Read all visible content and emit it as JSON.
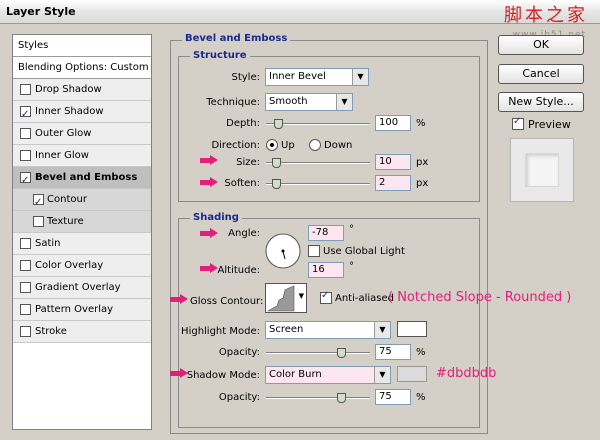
{
  "window": {
    "title": "Layer Style",
    "watermark": "脚本之家",
    "watermark_sub": "www.jb51.net"
  },
  "styles": {
    "header": "Styles",
    "blending": "Blending Options: Custom",
    "items": [
      {
        "label": "Drop Shadow",
        "checked": false
      },
      {
        "label": "Inner Shadow",
        "checked": true
      },
      {
        "label": "Outer Glow",
        "checked": false
      },
      {
        "label": "Inner Glow",
        "checked": false
      },
      {
        "label": "Bevel and Emboss",
        "checked": true,
        "selected": true
      },
      {
        "label": "Contour",
        "checked": true,
        "sub": true
      },
      {
        "label": "Texture",
        "checked": false,
        "sub": true
      },
      {
        "label": "Satin",
        "checked": false
      },
      {
        "label": "Color Overlay",
        "checked": false
      },
      {
        "label": "Gradient Overlay",
        "checked": false
      },
      {
        "label": "Pattern Overlay",
        "checked": false
      },
      {
        "label": "Stroke",
        "checked": false
      }
    ]
  },
  "bevel": {
    "title": "Bevel and Emboss",
    "structure": {
      "title": "Structure",
      "style_label": "Style:",
      "style_value": "Inner Bevel",
      "technique_label": "Technique:",
      "technique_value": "Smooth",
      "depth_label": "Depth:",
      "depth_value": "100",
      "depth_unit": "%",
      "depth_level": 0.08,
      "direction_label": "Direction:",
      "dir_up": "Up",
      "dir_down": "Down",
      "direction_selected": "Up",
      "size_label": "Size:",
      "size_value": "10",
      "size_unit": "px",
      "size_level": 0.06,
      "soften_label": "Soften:",
      "soften_value": "2",
      "soften_unit": "px",
      "soften_level": 0.06
    },
    "shading": {
      "title": "Shading",
      "angle_label": "Angle:",
      "angle_value": "-78",
      "angle_unit": "°",
      "global_light_label": "Use Global Light",
      "global_light": false,
      "altitude_label": "Altitude:",
      "altitude_value": "16",
      "altitude_unit": "°",
      "gloss_label": "Gloss Contour:",
      "anti_alias_label": "Anti-aliased",
      "anti_alias": true,
      "gloss_note": "( Notched Slope - Rounded )",
      "highlight_mode_label": "Highlight Mode:",
      "highlight_mode": "Screen",
      "highlight_color": "#ffffff",
      "highlight_opacity_label": "Opacity:",
      "highlight_opacity": "75",
      "highlight_opacity_unit": "%",
      "shadow_mode_label": "Shadow Mode:",
      "shadow_mode": "Color Burn",
      "shadow_color": "#dbdbdb",
      "shadow_color_note": "#dbdbdb",
      "shadow_opacity_label": "Opacity:",
      "shadow_opacity": "75",
      "shadow_opacity_unit": "%"
    }
  },
  "buttons": {
    "ok": "OK",
    "cancel": "Cancel",
    "new_style": "New Style...",
    "preview_label": "Preview",
    "preview": true
  },
  "colors": {
    "annotation": "#e0207a",
    "group_title": "#1b2a8c"
  }
}
